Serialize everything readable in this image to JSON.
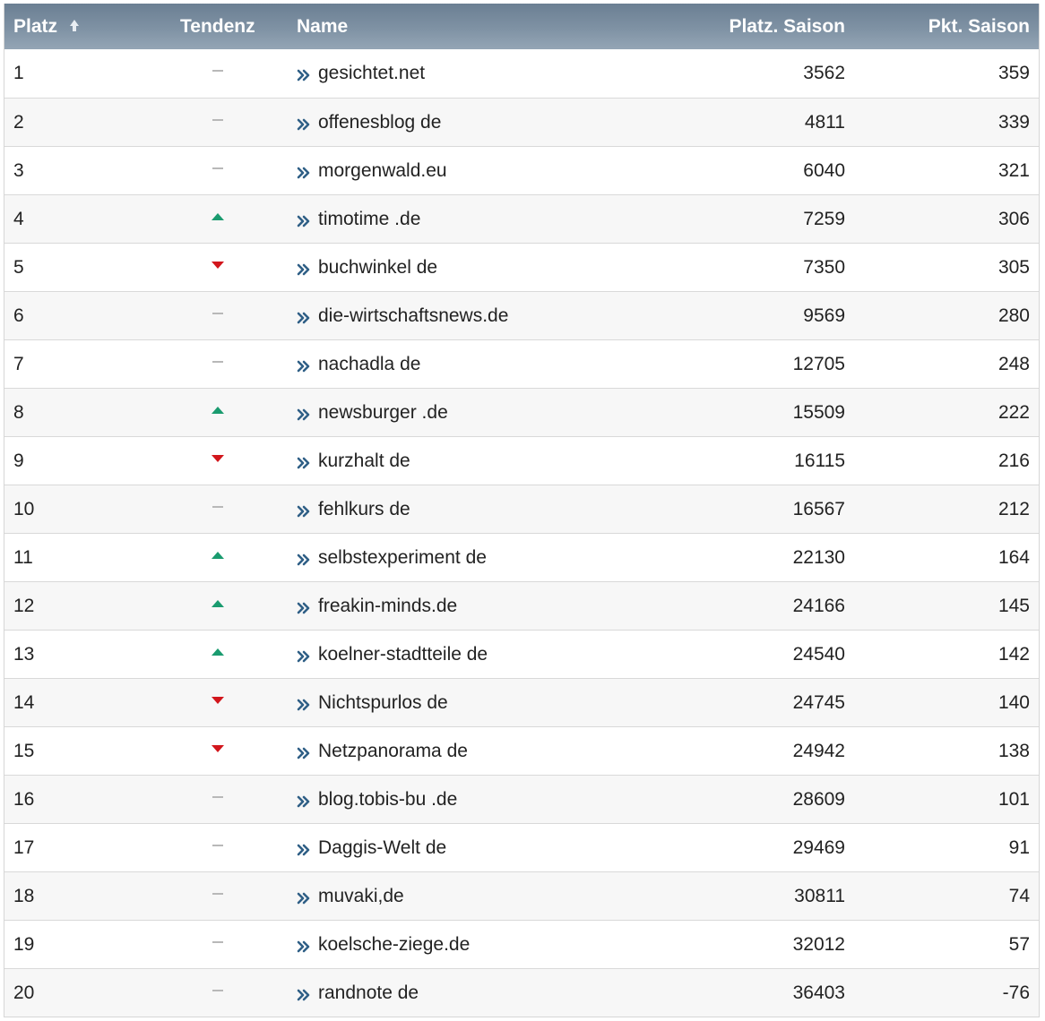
{
  "columns": {
    "platz": "Platz",
    "tendenz": "Tendenz",
    "name": "Name",
    "plaetze_saison": "Platz. Saison",
    "pkt_saison": "Pkt. Saison"
  },
  "icons": {
    "sort": "sort-up-arrow-icon",
    "link": "double-chevron-right-icon",
    "trend_same": "dash-icon",
    "trend_up": "triangle-up-icon",
    "trend_down": "triangle-down-icon"
  },
  "colors": {
    "header_bg": "#7f92a4",
    "trend_up": "#1a9b6f",
    "trend_down": "#d2161c",
    "trend_same": "#b8b8b8",
    "link_icon": "#2f5f86"
  },
  "rows": [
    {
      "platz": "1",
      "tendenz": "same",
      "name": "gesichtet.net",
      "plaetze_saison": "3562",
      "pkt_saison": "359"
    },
    {
      "platz": "2",
      "tendenz": "same",
      "name": "offenesblog de",
      "plaetze_saison": "4811",
      "pkt_saison": "339"
    },
    {
      "platz": "3",
      "tendenz": "same",
      "name": "morgenwald.eu",
      "plaetze_saison": "6040",
      "pkt_saison": "321"
    },
    {
      "platz": "4",
      "tendenz": "up",
      "name": "timotime .de",
      "plaetze_saison": "7259",
      "pkt_saison": "306"
    },
    {
      "platz": "5",
      "tendenz": "down",
      "name": "buchwinkel de",
      "plaetze_saison": "7350",
      "pkt_saison": "305"
    },
    {
      "platz": "6",
      "tendenz": "same",
      "name": "die-wirtschaftsnews.de",
      "plaetze_saison": "9569",
      "pkt_saison": "280"
    },
    {
      "platz": "7",
      "tendenz": "same",
      "name": "nachadla de",
      "plaetze_saison": "12705",
      "pkt_saison": "248"
    },
    {
      "platz": "8",
      "tendenz": "up",
      "name": "newsburger .de",
      "plaetze_saison": "15509",
      "pkt_saison": "222"
    },
    {
      "platz": "9",
      "tendenz": "down",
      "name": "kurzhalt de",
      "plaetze_saison": "16115",
      "pkt_saison": "216"
    },
    {
      "platz": "10",
      "tendenz": "same",
      "name": "fehlkurs de",
      "plaetze_saison": "16567",
      "pkt_saison": "212"
    },
    {
      "platz": "11",
      "tendenz": "up",
      "name": "selbstexperiment de",
      "plaetze_saison": "22130",
      "pkt_saison": "164"
    },
    {
      "platz": "12",
      "tendenz": "up",
      "name": "freakin-minds.de",
      "plaetze_saison": "24166",
      "pkt_saison": "145"
    },
    {
      "platz": "13",
      "tendenz": "up",
      "name": "koelner-stadtteile de",
      "plaetze_saison": "24540",
      "pkt_saison": "142"
    },
    {
      "platz": "14",
      "tendenz": "down",
      "name": "Nichtspurlos de",
      "plaetze_saison": "24745",
      "pkt_saison": "140"
    },
    {
      "platz": "15",
      "tendenz": "down",
      "name": "Netzpanorama de",
      "plaetze_saison": "24942",
      "pkt_saison": "138"
    },
    {
      "platz": "16",
      "tendenz": "same",
      "name": "blog.tobis-bu .de",
      "plaetze_saison": "28609",
      "pkt_saison": "101"
    },
    {
      "platz": "17",
      "tendenz": "same",
      "name": "Daggis-Welt de",
      "plaetze_saison": "29469",
      "pkt_saison": "91"
    },
    {
      "platz": "18",
      "tendenz": "same",
      "name": "muvaki,de",
      "plaetze_saison": "30811",
      "pkt_saison": "74"
    },
    {
      "platz": "19",
      "tendenz": "same",
      "name": "koelsche-ziege.de",
      "plaetze_saison": "32012",
      "pkt_saison": "57"
    },
    {
      "platz": "20",
      "tendenz": "same",
      "name": "randnote de",
      "plaetze_saison": "36403",
      "pkt_saison": "-76"
    }
  ]
}
